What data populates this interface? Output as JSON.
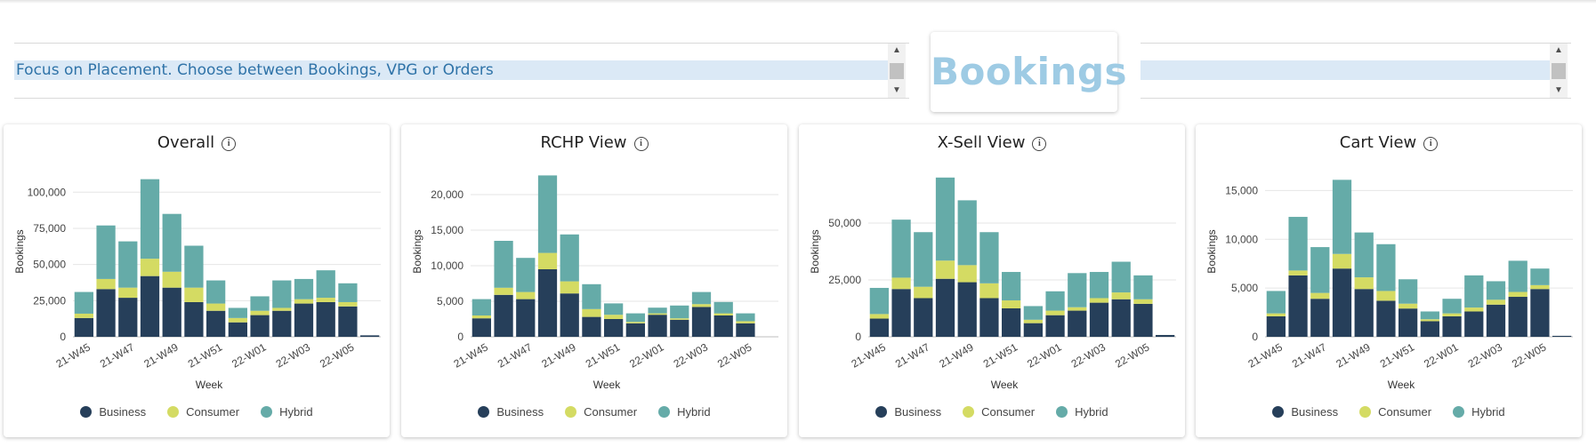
{
  "header": {
    "prompt": "Focus on Placement. Choose between Bookings, VPG or Orders",
    "metric": "Bookings"
  },
  "colors": {
    "Business": "#263f5a",
    "Consumer": "#d4db63",
    "Hybrid": "#65aba8"
  },
  "chart_data": [
    {
      "type": "bar",
      "stacked": true,
      "title": "Overall",
      "xlabel": "Week",
      "ylabel": "Bookings",
      "ylim": [
        0,
        118000
      ],
      "yticks": [
        0,
        25000,
        50000,
        75000,
        100000
      ],
      "ytick_labels": [
        "0",
        "25,000",
        "50,000",
        "75,000",
        "100,000"
      ],
      "categories": [
        "21-W45",
        "21-W46",
        "21-W47",
        "21-W48",
        "21-W49",
        "21-W50",
        "21-W51",
        "21-W52",
        "22-W01",
        "22-W02",
        "22-W03",
        "22-W04",
        "22-W05",
        "22-W06"
      ],
      "xtick_labels": [
        "21-W45",
        "21-W47",
        "21-W49",
        "21-W51",
        "22-W01",
        "22-W03",
        "22-W05"
      ],
      "series": [
        {
          "name": "Business",
          "values": [
            13000,
            33000,
            27000,
            42000,
            34000,
            24000,
            18000,
            10000,
            15000,
            18000,
            23000,
            24000,
            21000,
            1000
          ]
        },
        {
          "name": "Consumer",
          "values": [
            3000,
            7000,
            7000,
            12000,
            11000,
            10000,
            5000,
            3000,
            3000,
            2000,
            3000,
            3000,
            3000,
            0
          ]
        },
        {
          "name": "Hybrid",
          "values": [
            15000,
            37000,
            32000,
            55000,
            40000,
            29000,
            16000,
            7000,
            10000,
            19000,
            14000,
            19000,
            13000,
            0
          ]
        }
      ],
      "legend": [
        "Business",
        "Consumer",
        "Hybrid"
      ],
      "legend_position": "bottom"
    },
    {
      "type": "bar",
      "stacked": true,
      "title": "RCHP View",
      "xlabel": "Week",
      "ylabel": "Bookings",
      "ylim": [
        0,
        24000
      ],
      "yticks": [
        0,
        5000,
        10000,
        15000,
        20000
      ],
      "ytick_labels": [
        "0",
        "5,000",
        "10,000",
        "15,000",
        "20,000"
      ],
      "categories": [
        "21-W45",
        "21-W46",
        "21-W47",
        "21-W48",
        "21-W49",
        "21-W50",
        "21-W51",
        "21-W52",
        "22-W01",
        "22-W02",
        "22-W03",
        "22-W04",
        "22-W05",
        "22-W06"
      ],
      "xtick_labels": [
        "21-W45",
        "21-W47",
        "21-W49",
        "21-W51",
        "22-W01",
        "22-W03",
        "22-W05"
      ],
      "series": [
        {
          "name": "Business",
          "values": [
            2600,
            5900,
            5300,
            9500,
            6100,
            2800,
            2500,
            1900,
            3100,
            2400,
            4200,
            3000,
            1900,
            0
          ]
        },
        {
          "name": "Consumer",
          "values": [
            400,
            1000,
            1000,
            2300,
            1700,
            1100,
            600,
            200,
            200,
            200,
            400,
            300,
            300,
            0
          ]
        },
        {
          "name": "Hybrid",
          "values": [
            2300,
            6600,
            4800,
            10900,
            6600,
            3500,
            1600,
            1200,
            800,
            1800,
            1700,
            1600,
            1100,
            0
          ]
        }
      ],
      "legend": [
        "Business",
        "Consumer",
        "Hybrid"
      ],
      "legend_position": "bottom"
    },
    {
      "type": "bar",
      "stacked": true,
      "title": "X-Sell View",
      "xlabel": "Week",
      "ylabel": "Bookings",
      "ylim": [
        0,
        75000
      ],
      "yticks": [
        0,
        25000,
        50000
      ],
      "ytick_labels": [
        "0",
        "25,000",
        "50,000"
      ],
      "categories": [
        "21-W45",
        "21-W46",
        "21-W47",
        "21-W48",
        "21-W49",
        "21-W50",
        "21-W51",
        "21-W52",
        "22-W01",
        "22-W02",
        "22-W03",
        "22-W04",
        "22-W05",
        "22-W06"
      ],
      "xtick_labels": [
        "21-W45",
        "21-W47",
        "21-W49",
        "21-W51",
        "22-W01",
        "22-W03",
        "22-W05"
      ],
      "series": [
        {
          "name": "Business",
          "values": [
            8000,
            21000,
            17000,
            25500,
            24000,
            17000,
            12500,
            6000,
            9500,
            11500,
            15000,
            16500,
            14500,
            800
          ]
        },
        {
          "name": "Consumer",
          "values": [
            2000,
            5000,
            5000,
            8000,
            7500,
            6500,
            3500,
            1500,
            2000,
            1500,
            2000,
            3000,
            2000,
            0
          ]
        },
        {
          "name": "Hybrid",
          "values": [
            11500,
            25500,
            24000,
            36500,
            28500,
            22500,
            12500,
            6000,
            8500,
            15000,
            11500,
            13500,
            10500,
            0
          ]
        }
      ],
      "legend": [
        "Business",
        "Consumer",
        "Hybrid"
      ],
      "legend_position": "bottom"
    },
    {
      "type": "bar",
      "stacked": true,
      "title": "Cart View",
      "xlabel": "Week",
      "ylabel": "Bookings",
      "ylim": [
        0,
        17500
      ],
      "yticks": [
        0,
        5000,
        10000,
        15000
      ],
      "ytick_labels": [
        "0",
        "5,000",
        "10,000",
        "15,000"
      ],
      "categories": [
        "21-W45",
        "21-W46",
        "21-W47",
        "21-W48",
        "21-W49",
        "21-W50",
        "21-W51",
        "21-W52",
        "22-W01",
        "22-W02",
        "22-W03",
        "22-W04",
        "22-W05",
        "22-W06"
      ],
      "xtick_labels": [
        "21-W45",
        "21-W47",
        "21-W49",
        "21-W51",
        "22-W01",
        "22-W03",
        "22-W05"
      ],
      "series": [
        {
          "name": "Business",
          "values": [
            2100,
            6300,
            3900,
            7000,
            4900,
            3700,
            2900,
            1600,
            2100,
            2600,
            3300,
            4100,
            4900,
            100
          ]
        },
        {
          "name": "Consumer",
          "values": [
            300,
            500,
            600,
            1500,
            1200,
            1000,
            500,
            200,
            300,
            400,
            500,
            500,
            400,
            0
          ]
        },
        {
          "name": "Hybrid",
          "values": [
            2300,
            5500,
            4700,
            7600,
            4600,
            4800,
            2500,
            800,
            1500,
            3300,
            1900,
            3200,
            1700,
            0
          ]
        }
      ],
      "legend": [
        "Business",
        "Consumer",
        "Hybrid"
      ],
      "legend_position": "bottom"
    }
  ]
}
